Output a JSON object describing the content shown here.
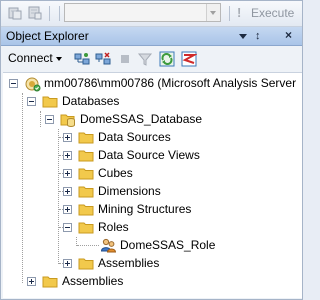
{
  "toolbar": {
    "database_combo_value": "",
    "execute_label": "Execute",
    "execute_symbol": "!"
  },
  "panel": {
    "title": "Object Explorer",
    "menu_icon": "dropdown-arrow-icon",
    "pin_symbol": "↕",
    "close_symbol": "×"
  },
  "oe_toolbar": {
    "connect_label": "Connect",
    "icons": [
      "connect-object-icon",
      "disconnect-icon",
      "stop-icon",
      "filter-icon",
      "refresh-icon",
      "summary-report-icon"
    ]
  },
  "tree": {
    "server": "mm00786\\mm00786 (Microsoft Analysis Server",
    "databases": "Databases",
    "database": "DomeSSAS_Database",
    "data_sources": "Data Sources",
    "data_source_views": "Data Source Views",
    "cubes": "Cubes",
    "dimensions": "Dimensions",
    "mining_structures": "Mining Structures",
    "roles": "Roles",
    "role": "DomeSSAS_Role",
    "db_assemblies": "Assemblies",
    "assemblies": "Assemblies"
  },
  "colors": {
    "folder": "#f2c94c",
    "folder_dark": "#c99a1f",
    "panel_title_bg": "#b8cfee",
    "refresh_green": "#3c9a3c",
    "report_red": "#d02a2a"
  }
}
